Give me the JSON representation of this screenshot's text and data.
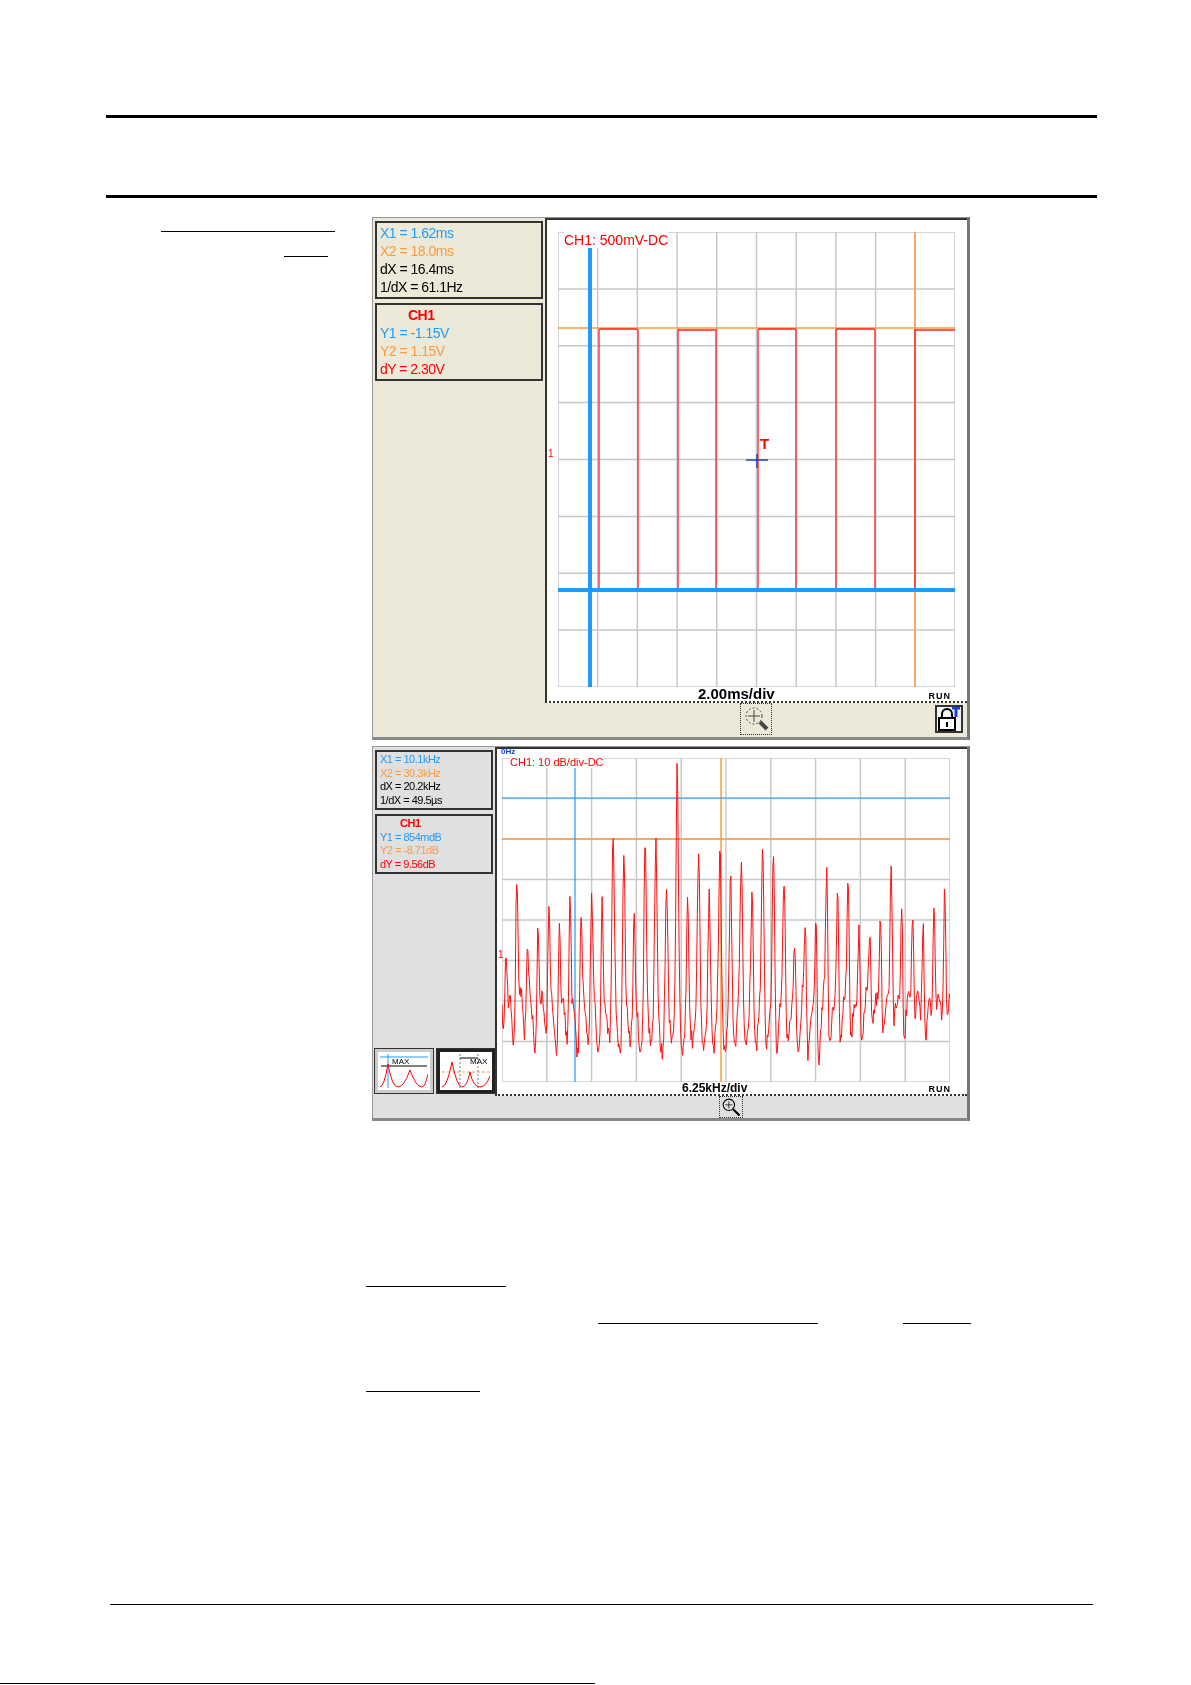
{
  "scopes": [
    {
      "kind": "time",
      "readout": [
        {
          "text": "X1 = 1.62ms",
          "color": "#1e9bff"
        },
        {
          "text": "X2 = 18.0ms",
          "color": "#ff9a3c"
        },
        {
          "text": "dX = 16.4ms",
          "color": "#000000"
        },
        {
          "text": "1/dX = 61.1Hz",
          "color": "#000000"
        }
      ],
      "channel": {
        "title": "CH1",
        "lines": [
          {
            "text": "Y1 = -1.15V",
            "color": "#1e9bff"
          },
          {
            "text": "Y2 = 1.15V",
            "color": "#ff9a3c"
          },
          {
            "text": "dY = 2.30V",
            "color": "#ff0000"
          }
        ]
      },
      "plot": {
        "channel_label": "CH1: 500mV-DC",
        "scale": "2.00ms/div",
        "status": "RUN",
        "channel_marker": "1",
        "trigger_marker": "T"
      }
    },
    {
      "kind": "spectrum",
      "readout": [
        {
          "text": "X1 = 10.1kHz",
          "color": "#1e9bff"
        },
        {
          "text": "X2 = 30.3kHz",
          "color": "#ff9a3c"
        },
        {
          "text": "dX = 20.2kHz",
          "color": "#000000"
        },
        {
          "text": "1/dX = 49.5µs",
          "color": "#000000"
        }
      ],
      "channel": {
        "title": "CH1",
        "lines": [
          {
            "text": "Y1 = 854mdB",
            "color": "#1e9bff"
          },
          {
            "text": "Y2 = -8.71dB",
            "color": "#ff9a3c"
          },
          {
            "text": "dY = 9.56dB",
            "color": "#ff0000"
          }
        ]
      },
      "plot": {
        "origin_label": "0Hz",
        "channel_label": "CH1: 10 dB/div-DC",
        "scale": "6.25kHz/div",
        "status": "RUN",
        "channel_marker": "1"
      },
      "mode_buttons": [
        {
          "label": "MAX",
          "selected": false
        },
        {
          "label": "MAX",
          "selected": true
        }
      ]
    }
  ]
}
